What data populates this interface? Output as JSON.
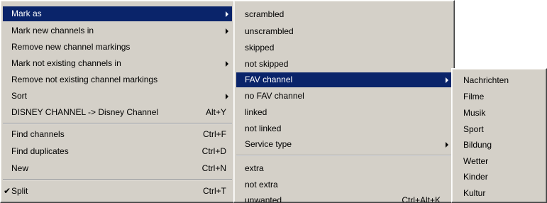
{
  "main_menu": {
    "mark_as": "Mark as",
    "mark_new": "Mark new channels in",
    "remove_new": "Remove new channel markings",
    "mark_not_existing": "Mark not existing channels in",
    "remove_not_existing": "Remove not existing channel markings",
    "sort": "Sort",
    "rename": "DISNEY CHANNEL -> Disney Channel",
    "rename_shortcut": "Alt+Y",
    "find_channels": "Find channels",
    "find_channels_shortcut": "Ctrl+F",
    "find_duplicates": "Find duplicates",
    "find_duplicates_shortcut": "Ctrl+D",
    "new": "New",
    "new_shortcut": "Ctrl+N",
    "split": "Split",
    "split_shortcut": "Ctrl+T",
    "split_checkmark": "✔"
  },
  "mark_as_menu": {
    "scrambled": "scrambled",
    "unscrambled": "unscrambled",
    "skipped": "skipped",
    "not_skipped": "not skipped",
    "fav_channel": "FAV channel",
    "no_fav_channel": "no FAV channel",
    "linked": "linked",
    "not_linked": "not linked",
    "service_type": "Service type",
    "extra": "extra",
    "not_extra": "not extra",
    "unwanted": "unwanted",
    "unwanted_shortcut": "Ctrl+Alt+K"
  },
  "fav_menu": {
    "items": [
      "Nachrichten",
      "Filme",
      "Musik",
      "Sport",
      "Bildung",
      "Wetter",
      "Kinder",
      "Kultur"
    ]
  },
  "colors": {
    "menu_background": "#d4d0c8",
    "highlight": "#0a246a",
    "highlight_text": "#ffffff"
  }
}
